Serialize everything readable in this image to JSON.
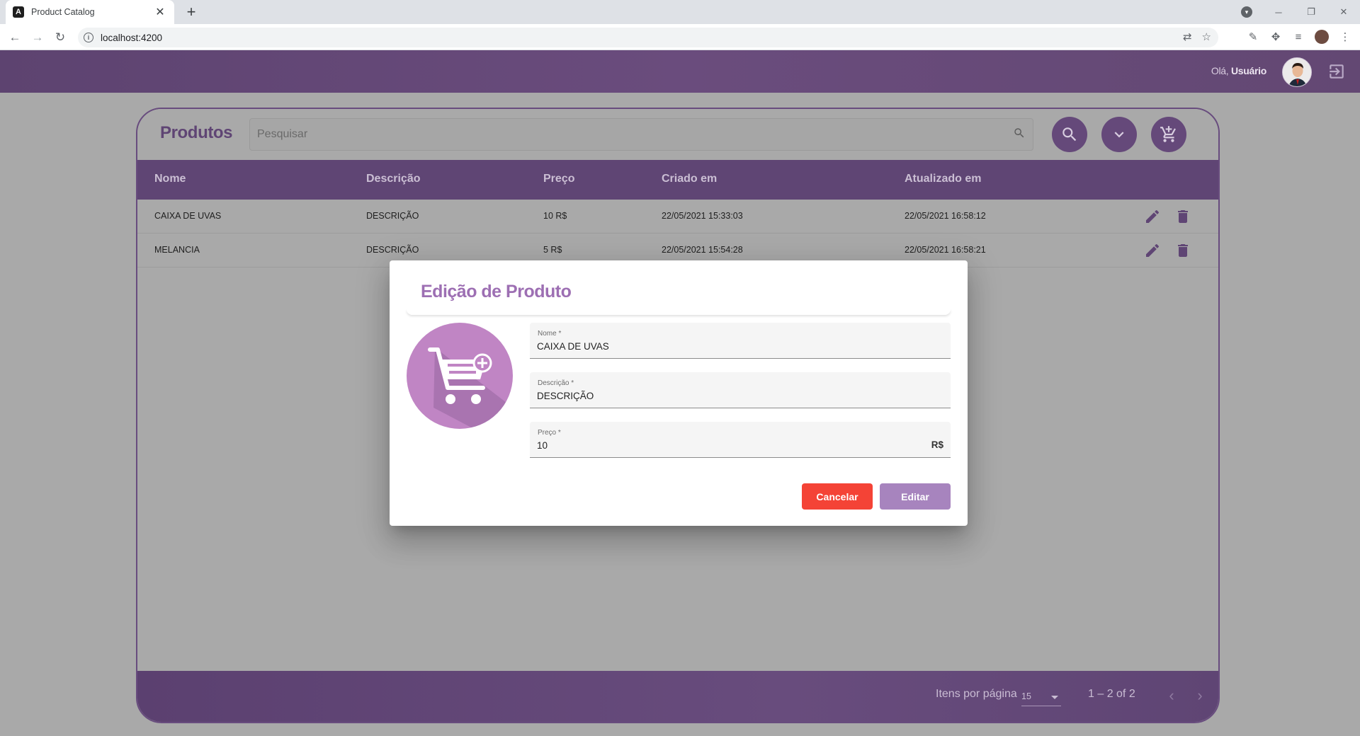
{
  "browser": {
    "tab_title": "Product Catalog",
    "tab_favicon": "A",
    "url": "localhost:4200",
    "new_tab": "+",
    "icons": [
      "back-icon",
      "forward-icon",
      "reload-icon",
      "info-icon",
      "translate-icon",
      "star-icon",
      "extension-icon",
      "puzzle-icon",
      "reading-list-icon",
      "profile-icon",
      "menu-icon"
    ]
  },
  "header": {
    "greeting_prefix": "Olá,",
    "user_name": "Usuário",
    "colors": {
      "bar": "#634873",
      "accent": "#65497a"
    }
  },
  "products": {
    "title": "Produtos",
    "search_placeholder": "Pesquisar",
    "columns": [
      "Nome",
      "Descrição",
      "Preço",
      "Criado em",
      "Atualizado em"
    ],
    "rows": [
      {
        "nome": "CAIXA DE UVAS",
        "descricao": "DESCRIÇÃO",
        "preco": "10 R$",
        "criado": "22/05/2021 15:33:03",
        "atualizado": "22/05/2021 16:58:12"
      },
      {
        "nome": "MELANCIA",
        "descricao": "DESCRIÇÃO",
        "preco": "5 R$",
        "criado": "22/05/2021 15:54:28",
        "atualizado": "22/05/2021 16:58:21"
      }
    ]
  },
  "paginator": {
    "label": "Itens por página",
    "page_size": "15",
    "range": "1 – 2 of 2"
  },
  "dialog": {
    "title": "Edição de Produto",
    "fields": {
      "nome": {
        "label": "Nome *",
        "value": "CAIXA DE UVAS"
      },
      "descricao": {
        "label": "Descrição *",
        "value": "DESCRIÇÃO"
      },
      "preco": {
        "label": "Preço *",
        "value": "10",
        "suffix": "R$"
      }
    },
    "cancel_label": "Cancelar",
    "edit_label": "Editar",
    "colors": {
      "title": "#9d6fb3",
      "cancel": "#f44336",
      "edit": "#a784be",
      "image": "#c085c4"
    }
  }
}
